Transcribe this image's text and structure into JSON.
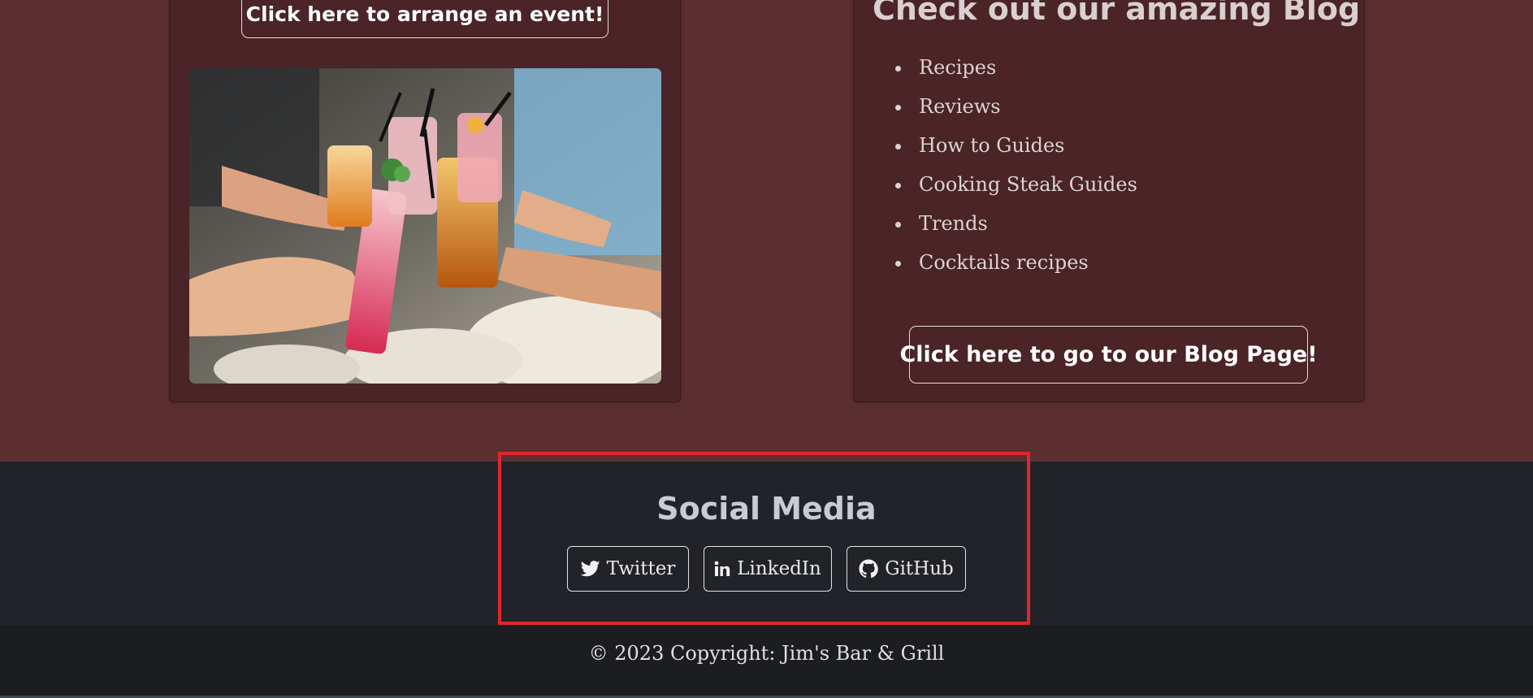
{
  "events_card": {
    "button_label": "Click here to arrange an event!",
    "image_alt": "Friends toasting colorful cocktails"
  },
  "blog_card": {
    "title": "Check out our amazing Blog",
    "items": [
      {
        "label": "Recipes"
      },
      {
        "label": "Reviews"
      },
      {
        "label": "How to Guides"
      },
      {
        "label": "Cooking Steak Guides"
      },
      {
        "label": "Trends"
      },
      {
        "label": "Cocktails recipes"
      }
    ],
    "button_label": "Click here to go to our Blog Page!"
  },
  "social": {
    "title": "Social Media",
    "twitter": {
      "label": "Twitter",
      "icon": "twitter-icon"
    },
    "linkedin": {
      "label": "LinkedIn",
      "icon": "linkedin-icon"
    },
    "github": {
      "label": "GitHub",
      "icon": "github-icon"
    }
  },
  "footer": {
    "copyright": "© 2023 Copyright: Jim's Bar & Grill"
  },
  "colors": {
    "page_bg": "#5b2f30",
    "card_bg": "#4a2426",
    "footer_bg": "#212328",
    "copyright_bg": "#1c1d20",
    "highlight": "#e0262f"
  }
}
